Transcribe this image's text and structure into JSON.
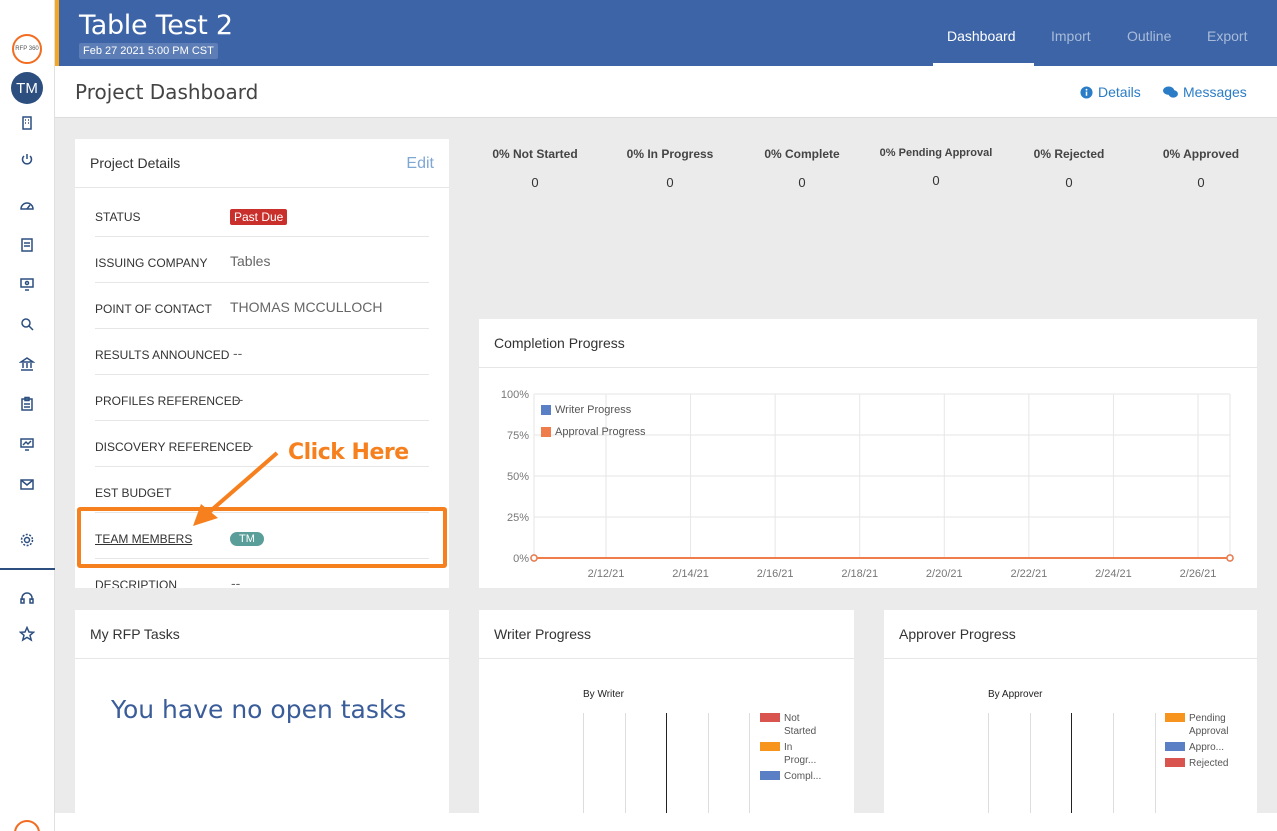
{
  "sidebar": {
    "logo_text": "RFP 360",
    "avatar_initials": "TM",
    "icons": [
      "building-icon",
      "power-icon",
      "dashboard-icon",
      "document-icon",
      "monitor-icon",
      "search-icon",
      "bank-icon",
      "clipboard-icon",
      "chart-monitor-icon",
      "mail-icon",
      "gear-icon",
      "headset-icon",
      "star-icon"
    ]
  },
  "header": {
    "title": "Table Test 2",
    "due_date": "Feb 27 2021 5:00 PM CST",
    "tabs": [
      {
        "label": "Dashboard",
        "active": true
      },
      {
        "label": "Import",
        "active": false
      },
      {
        "label": "Outline",
        "active": false
      },
      {
        "label": "Export",
        "active": false
      }
    ],
    "accent_color": "#f5a623",
    "bg_color": "#3c64a6"
  },
  "subheader": {
    "page_title": "Project Dashboard",
    "details_link": "Details",
    "messages_link": "Messages"
  },
  "project_details": {
    "title": "Project Details",
    "edit_label": "Edit",
    "rows": [
      {
        "label": "STATUS",
        "value": "Past Due"
      },
      {
        "label": "ISSUING COMPANY",
        "value": "Tables"
      },
      {
        "label": "POINT OF CONTACT",
        "value": "THOMAS MCCULLOCH"
      },
      {
        "label": "RESULTS ANNOUNCED",
        "value": "--"
      },
      {
        "label": "PROFILES REFERENCED",
        "value": "--"
      },
      {
        "label": "DISCOVERY REFERENCED",
        "value": "--"
      },
      {
        "label": "EST BUDGET",
        "value": ""
      },
      {
        "label": "TEAM MEMBERS",
        "value": "TM"
      },
      {
        "label": "DESCRIPTION",
        "value": "--"
      }
    ]
  },
  "annotation": {
    "text": "Click Here",
    "color": "#f6801e"
  },
  "stats": [
    {
      "label": "0% Not Started",
      "value": "0"
    },
    {
      "label": "0% In Progress",
      "value": "0"
    },
    {
      "label": "0% Complete",
      "value": "0"
    },
    {
      "label": "0% Pending Approval",
      "value": "0"
    },
    {
      "label": "0% Rejected",
      "value": "0"
    },
    {
      "label": "0% Approved",
      "value": "0"
    }
  ],
  "completion_progress": {
    "title": "Completion Progress",
    "legend": [
      {
        "name": "Writer Progress",
        "color": "#5b7fc4"
      },
      {
        "name": "Approval Progress",
        "color": "#ef7d4b"
      }
    ]
  },
  "tasks": {
    "title": "My RFP Tasks",
    "empty_message": "You have no open tasks"
  },
  "writer_progress": {
    "title": "Writer Progress",
    "chart_title": "By Writer",
    "legend": [
      {
        "name": "Not Started",
        "color": "#d9534f"
      },
      {
        "name": "In Progr...",
        "color": "#f7941d"
      },
      {
        "name": "Compl...",
        "color": "#5b7fc4"
      }
    ]
  },
  "approver_progress": {
    "title": "Approver Progress",
    "chart_title": "By Approver",
    "legend": [
      {
        "name": "Pending Approval",
        "color": "#f7941d"
      },
      {
        "name": "Appro...",
        "color": "#5b7fc4"
      },
      {
        "name": "Rejected",
        "color": "#d9534f"
      }
    ]
  },
  "chart_data": {
    "type": "line",
    "title": "",
    "xlabel": "",
    "ylabel": "",
    "x": [
      "2/11/21",
      "2/27/21"
    ],
    "x_ticks": [
      "2/12/21",
      "2/14/21",
      "2/16/21",
      "2/18/21",
      "2/20/21",
      "2/22/21",
      "2/24/21",
      "2/26/21"
    ],
    "y_ticks": [
      "100%",
      "75%",
      "50%",
      "25%",
      "0%"
    ],
    "ylim": [
      0,
      100
    ],
    "series": [
      {
        "name": "Writer Progress",
        "values": [
          0,
          0
        ],
        "color": "#5b7fc4"
      },
      {
        "name": "Approval Progress",
        "values": [
          0,
          0
        ],
        "color": "#ef7d4b"
      }
    ],
    "grid": true,
    "legend_position": "top-left"
  }
}
